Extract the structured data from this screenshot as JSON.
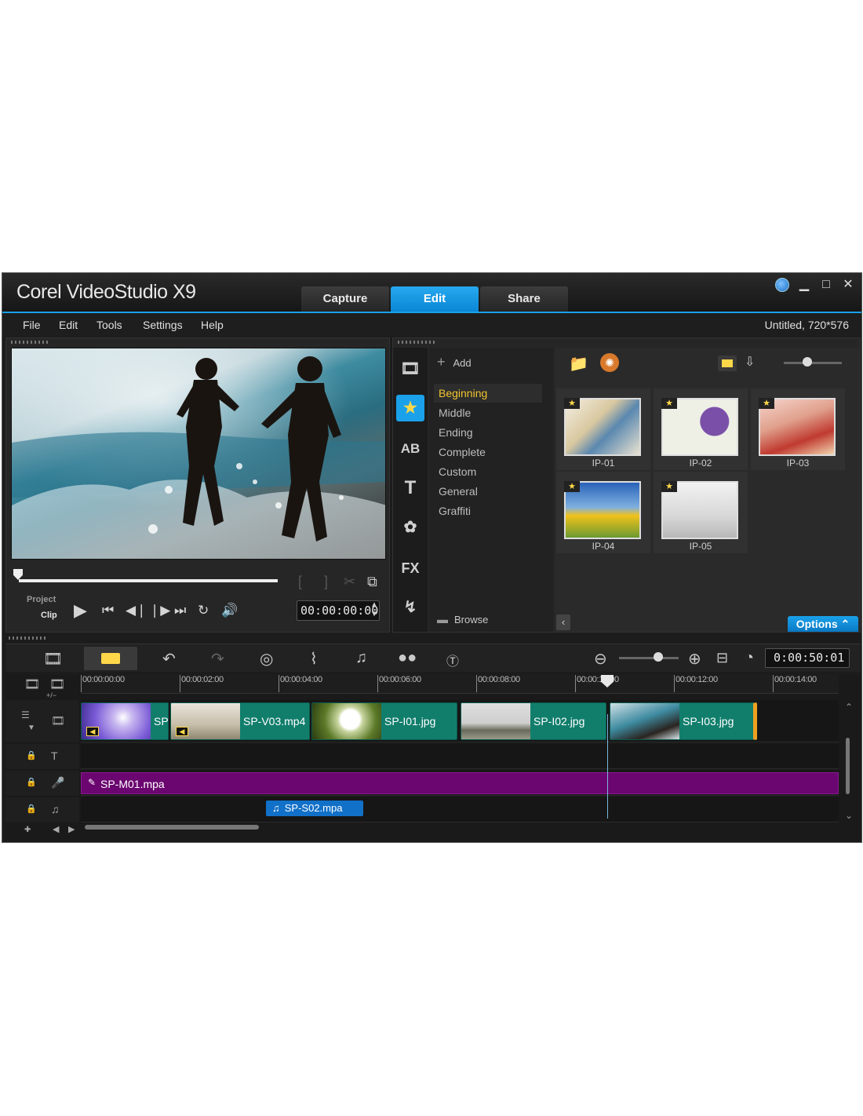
{
  "app": {
    "title": "Corel VideoStudio X9",
    "tabs": [
      "Capture",
      "Edit",
      "Share"
    ],
    "active_tab": "Edit",
    "project_info": "Untitled, 720*576",
    "accent_color": "#1aa1ea"
  },
  "menu": [
    "File",
    "Edit",
    "Tools",
    "Settings",
    "Help"
  ],
  "player": {
    "mode_project": "Project",
    "mode_clip": "Clip",
    "timecode": "00:00:00:00"
  },
  "library": {
    "add_label": "Add",
    "browse_label": "Browse",
    "options_label": "Options",
    "categories": [
      "Beginning",
      "Middle",
      "Ending",
      "Complete",
      "Custom",
      "General",
      "Graffiti"
    ],
    "active_category": "Beginning",
    "thumbnails": [
      "IP-01",
      "IP-02",
      "IP-03",
      "IP-04",
      "IP-05"
    ],
    "side_icons": [
      "media-icon",
      "instant-project-icon",
      "transition-icon",
      "title-icon",
      "graphic-icon",
      "filter-icon",
      "path-icon"
    ]
  },
  "toolbar": {
    "project_timecode": "0:00:50:01"
  },
  "timeline": {
    "ruler": [
      "00:00:00:00",
      "00:00:02:00",
      "00:00:04:00",
      "00:00:06:00",
      "00:00:08:00",
      "00:00:10:00",
      "00:00:12:00",
      "00:00:14:00"
    ],
    "ruler_plus_minus": "+/−",
    "video_clips": [
      "SP",
      "SP-V03.mp4",
      "SP-I01.jpg",
      "SP-I02.jpg",
      "SP-I03.jpg"
    ],
    "music_clip": "SP-M01.mpa",
    "voice_clip": "SP-S02.mpa",
    "music_color": "#6b0670",
    "clip_color": "#117e6c"
  }
}
